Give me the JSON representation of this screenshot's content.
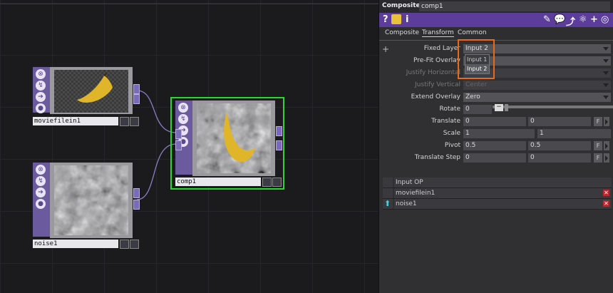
{
  "nodes": {
    "moviefilein": {
      "name": "moviefilein1"
    },
    "noise": {
      "name": "noise1"
    },
    "comp": {
      "name": "comp1"
    }
  },
  "panel": {
    "type_label": "Composite",
    "node_name": "comp1",
    "toolbar_left": [
      "?",
      "i"
    ],
    "tabs": [
      "Composite",
      "Transform",
      "Common"
    ],
    "active_tab": "Transform",
    "params": {
      "fixed_layer": {
        "label": "Fixed Layer",
        "value": "Input 2"
      },
      "prefit_overlay": {
        "label": "Pre-Fit Overlay",
        "value": ""
      },
      "justify_horizontal": {
        "label": "Justify Horizontal",
        "value": ""
      },
      "justify_vertical": {
        "label": "Justify Vertical",
        "value": "Center"
      },
      "extend_overlay": {
        "label": "Extend Overlay",
        "value": "Zero"
      },
      "rotate": {
        "label": "Rotate",
        "value": "0"
      },
      "translate": {
        "label": "Translate",
        "x": "0",
        "y": "0"
      },
      "scale": {
        "label": "Scale",
        "x": "1",
        "y": "1"
      },
      "pivot": {
        "label": "Pivot",
        "x": "0.5",
        "y": "0.5"
      },
      "translate_step": {
        "label": "Translate Step",
        "x": "0",
        "y": "0"
      }
    },
    "dropdown_options": [
      "Input 1",
      "Input 2"
    ],
    "fbutton": "F",
    "inputs_table": {
      "header": "Input OP",
      "rows": [
        "moviefilein1",
        "noise1"
      ]
    }
  },
  "colors": {
    "selected_border": "#2ed33a",
    "accent": "#5c3d9b",
    "highlight": "#e86a1f"
  }
}
